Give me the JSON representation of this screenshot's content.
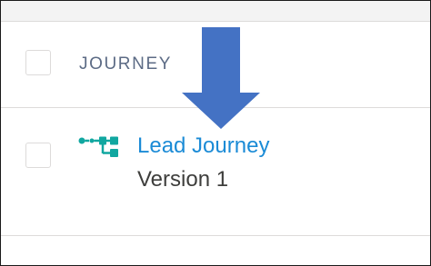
{
  "table": {
    "column_header": "JOURNEY",
    "rows": [
      {
        "name": "Lead Journey",
        "version": "Version 1",
        "icon": "journey-flow-icon"
      }
    ]
  },
  "annotation": {
    "type": "down-arrow",
    "color": "#4472c4"
  },
  "colors": {
    "link": "#1b8bd6",
    "icon": "#11a7a0",
    "header_text": "#5c6b85",
    "arrow": "#4472c4"
  }
}
